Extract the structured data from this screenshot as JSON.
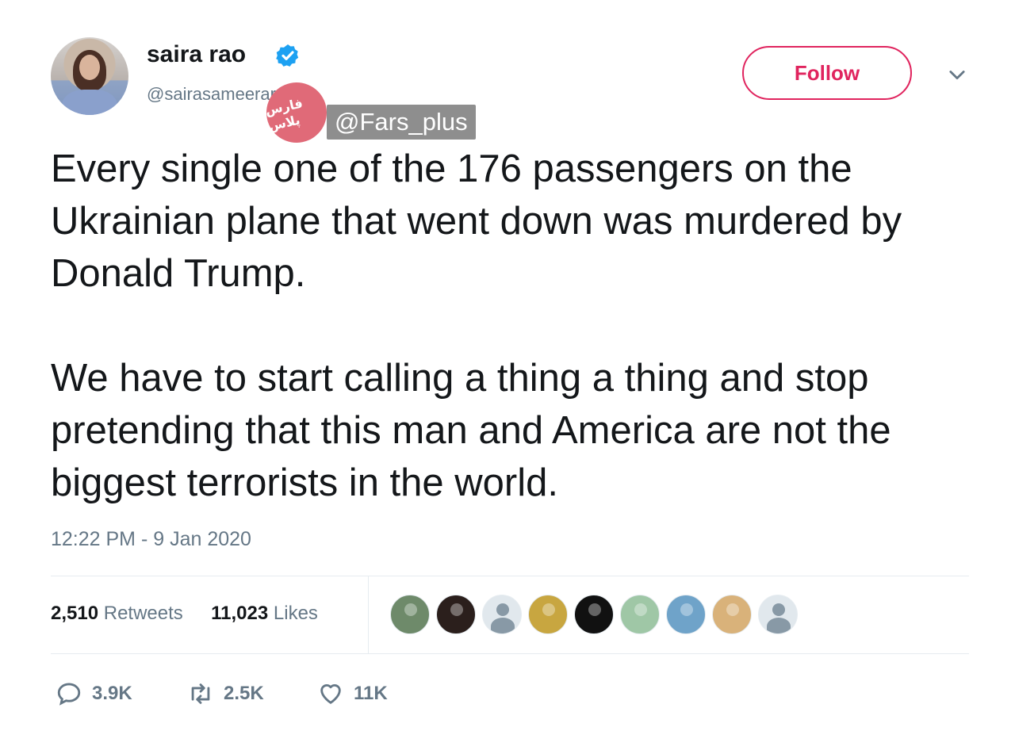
{
  "user": {
    "name": "saira rao",
    "handle": "@sairasameerarao",
    "follow_label": "Follow"
  },
  "watermark": {
    "circle_text": "فارس پلاس",
    "tag": "@Fars_plus"
  },
  "tweet": {
    "paragraphs": [
      "Every single one of the 176 passengers on the Ukrainian plane that went down was murdered by Donald Trump.",
      "We have to start calling a thing a thing and stop pretending that this man and America are not the biggest terrorists in the world."
    ],
    "timestamp": "12:22 PM - 9 Jan 2020"
  },
  "stats": {
    "retweets_count": "2,510",
    "retweets_label": "Retweets",
    "likes_count": "11,023",
    "likes_label": "Likes"
  },
  "liker_avatars": [
    {
      "color": "#6e8a6a"
    },
    {
      "color": "#2b1f1c"
    },
    {
      "color": "#e1e8ed",
      "default": true
    },
    {
      "color": "#c8a640"
    },
    {
      "color": "#111111"
    },
    {
      "color": "#9fc7a6"
    },
    {
      "color": "#6fa3c9"
    },
    {
      "color": "#d9b27a"
    },
    {
      "color": "#e1e8ed",
      "default": true
    }
  ],
  "actions": {
    "replies": "3.9K",
    "retweets": "2.5K",
    "likes": "11K"
  },
  "colors": {
    "accent": "#e0245e",
    "verified": "#1da1f2",
    "muted": "#657786"
  }
}
